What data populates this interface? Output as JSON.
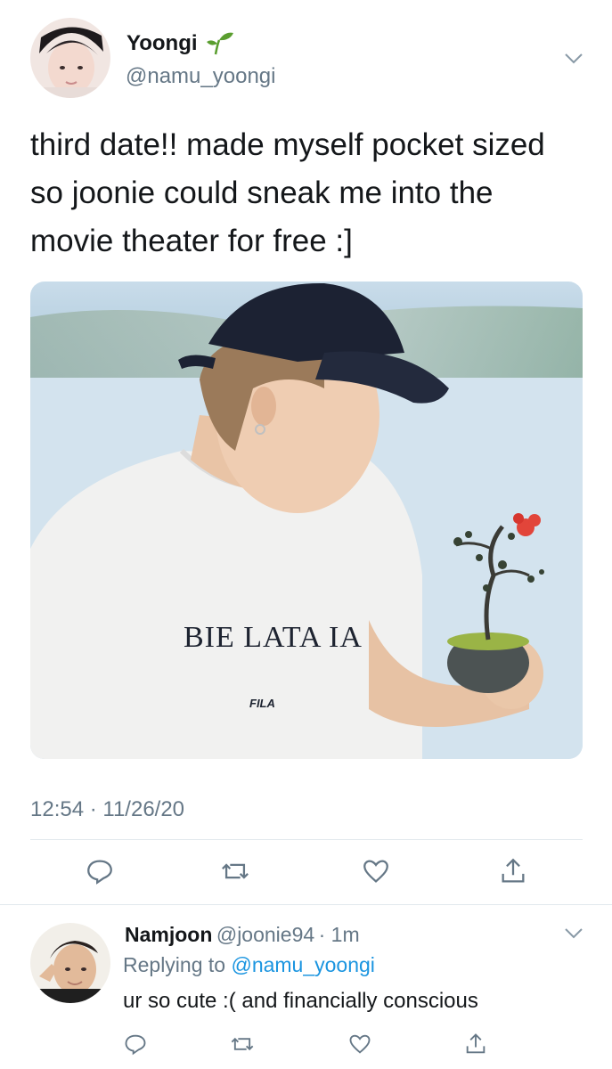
{
  "tweet": {
    "author": {
      "name": "Yoongi",
      "handle": "@namu_yoongi",
      "badge_icon": "sprout-icon",
      "badge_color": "#5a9e2f"
    },
    "text_lines": [
      "third date!! made myself pocket sized",
      "so joonie could sneak me into the",
      "movie theater for free :]"
    ],
    "timestamp": "12:54 · 11/26/20",
    "actions": [
      "reply-icon",
      "retweet-icon",
      "like-icon",
      "share-icon"
    ]
  },
  "reply": {
    "name": "Namjoon",
    "handle": "@joonie94",
    "time": "· 1m",
    "replying_prefix": "Replying to",
    "replying_to": "@namu_yoongi",
    "text": "ur so cute :( and financially conscious",
    "actions": [
      "reply-icon",
      "retweet-icon",
      "like-icon",
      "share-icon"
    ]
  },
  "photo": {
    "shirt_text": "BIE  LATA  IA",
    "shirt_brand": "FILA"
  },
  "colors": {
    "secondary": "#657786",
    "link": "#1b95e0",
    "divider": "#e1e8ed"
  }
}
